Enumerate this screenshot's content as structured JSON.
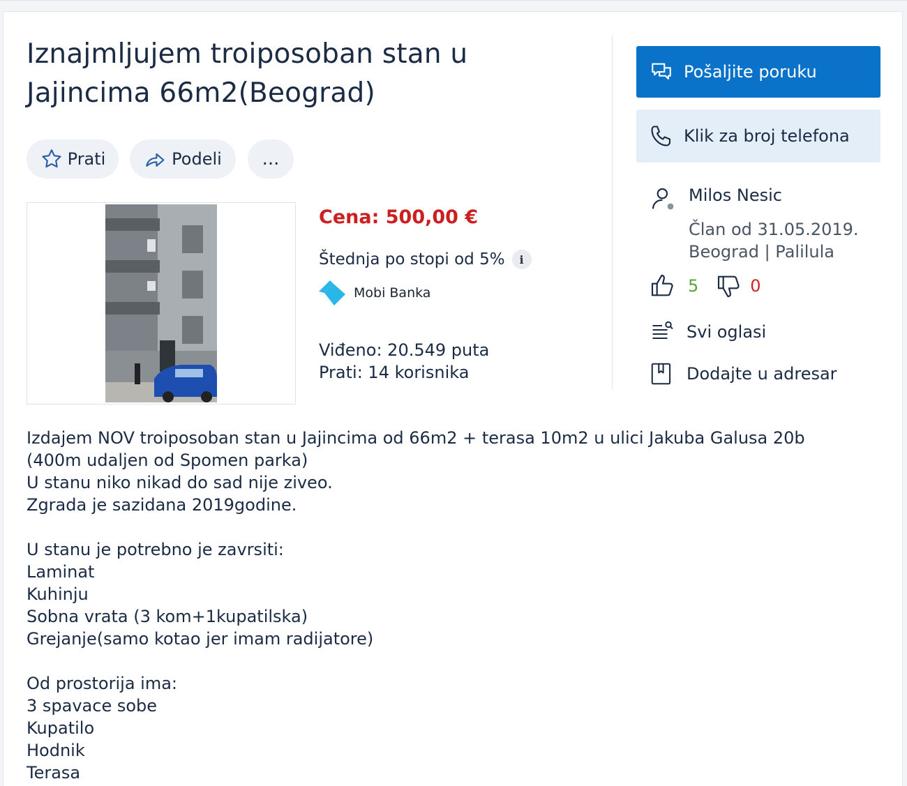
{
  "listing": {
    "title": "Iznajmljujem troiposoban stan u Jajincima 66m2(Beograd)",
    "actions": {
      "follow_label": "Prati",
      "share_label": "Podeli",
      "more_label": "..."
    },
    "price": "Cena: 500,00 €",
    "saving": "Štednja po stopi od 5%",
    "info_glyph": "i",
    "bank_name": "Mobi Banka",
    "views": "Viđeno: 20.549 puta",
    "followers": "Prati: 14 korisnika"
  },
  "seller": {
    "send_message_label": "Pošaljite poruku",
    "phone_label": "Klik za broj telefona",
    "name": "Milos Nesic",
    "member_since": "Član od 31.05.2019.",
    "location": "Beograd | Palilula",
    "positive": "5",
    "negative": "0",
    "all_ads_label": "Svi oglasi",
    "add_to_address_book_label": "Dodajte u adresar"
  },
  "description": {
    "paragraphs": [
      "Izdajem NOV troiposoban stan u Jajincima od 66m2 + terasa 10m2 u ulici Jakuba Galusa 20b\n(400m udaljen od Spomen parka)\nU stanu niko nikad do sad nije ziveo.\nZgrada je sazidana 2019godine.",
      "U stanu je potrebno je zavrsiti:\nLaminat\nKuhinju\nSobna vrata (3 kom+1kupatilska)\nGrejanje(samo kotao jer imam radijatore)",
      "Od prostorija ima:\n3 spavace sobe\nKupatilo\nHodnik\nTerasa"
    ]
  },
  "colors": {
    "primary": "#0a72c8",
    "price_red": "#cc1f1f",
    "positive_green": "#55a630",
    "negative_red": "#d32020"
  },
  "icons": [
    "star-icon",
    "share-icon",
    "chat-icon",
    "phone-icon",
    "user-icon",
    "thumbs-up-icon",
    "thumbs-down-icon",
    "list-search-icon",
    "address-book-icon",
    "mobi-banka-logo",
    "info-icon"
  ]
}
